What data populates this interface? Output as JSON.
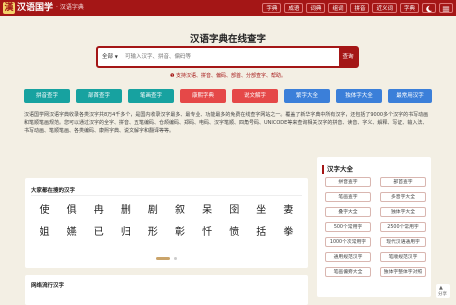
{
  "header": {
    "logo_mark": "漢",
    "logo_text": "汉语国学",
    "logo_sub": "· 汉语字典",
    "nav": [
      "字典",
      "成语",
      "词典",
      "组词",
      "拼音",
      "近义词",
      "字典"
    ]
  },
  "colors": {
    "brand": "#a41616",
    "background": "#f3efe4",
    "buttons": [
      "#17a2a0",
      "#17a2a0",
      "#17a2a0",
      "#e54848",
      "#e54848",
      "#3b7fd9",
      "#3b7fd9",
      "#3b7fd9"
    ]
  },
  "search": {
    "title": "汉语字典在线查字",
    "select_label": "全部",
    "placeholder": "可输入汉字、拼音、偏码等",
    "button": "查询",
    "tip": "支持汉语、拼音、偏码、部首、分部查字、帮助。"
  },
  "quick_buttons": [
    "拼音查字",
    "部首查字",
    "笔画查字",
    "康熙字典",
    "说文解字",
    "繁字大全",
    "独体字大全",
    "最常用汉字"
  ],
  "intro": {
    "text": "汉语国学网汉语字典收录各类汉字共8万4千多个，是国内收录汉字最多、最专业、功能最多的免费在线查字网站之一。覆盖了新华字典中所有汉字，还包括了9000多个汉字的书写动画和笔顺笔画规范。您可以通过汉字的全字、拼音、五笔编码、仓颉编码、郑码、电码、汉字笔顺、四角号码、UNICODE等来查询相关汉字的拼音、读音、字义、解释、写证、输入法、书写动画、笔顺笔画、各类编码、康熙字典、说文解字和翻译等等。"
  },
  "popular": {
    "title": "大家都在搜的汉字",
    "rows": [
      [
        "使",
        "俱",
        "冉",
        "删",
        "剧",
        "叙",
        "呆",
        "囹",
        "坐",
        "妻"
      ],
      [
        "姐",
        "嬿",
        "已",
        "归",
        "形",
        "彰",
        "忏",
        "愤",
        "括",
        "拳"
      ]
    ]
  },
  "network": {
    "title": "网络流行汉字"
  },
  "right_panel": {
    "title": "汉字大全",
    "items": [
      "拼音查字",
      "部首查字",
      "笔画查字",
      "多音字大全",
      "叠字大全",
      "独体字大全",
      "500个常用字",
      "2500个常用字",
      "1000个次常用字",
      "现代汉语通用字",
      "通用规范汉字",
      "笔顺规范汉字",
      "笔画偏旁大全",
      "独体字整体字对照"
    ]
  },
  "side_tool": {
    "label": "分享"
  }
}
